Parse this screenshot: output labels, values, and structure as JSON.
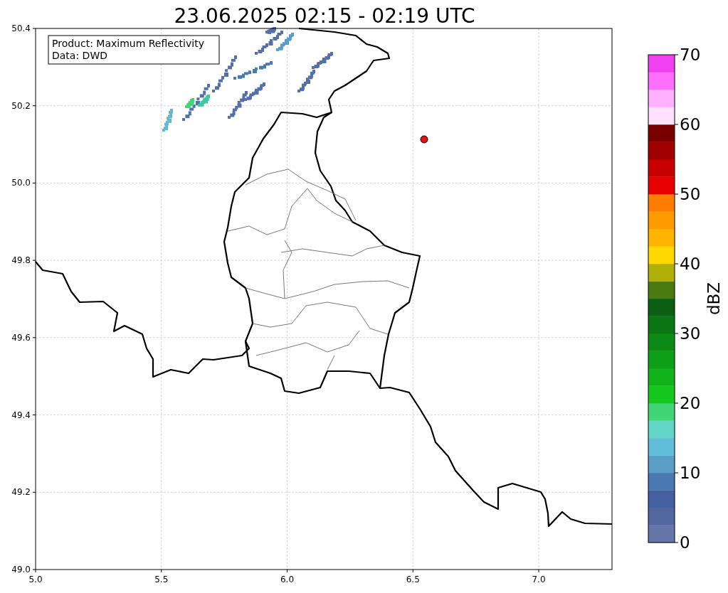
{
  "title": "23.06.2025 02:15 - 02:19 UTC",
  "legend": [
    "Product: Maximum Reflectivity",
    "Data: DWD"
  ],
  "map": {
    "x_ticks": [
      "5.0",
      "5.5",
      "6.0",
      "6.5",
      "7.0"
    ],
    "y_ticks": [
      "50.4",
      "50.2",
      "50.0",
      "49.8",
      "49.6",
      "49.4",
      "49.2",
      "49.0"
    ]
  },
  "colorbar": {
    "label": "dBZ",
    "ticks": [
      "70",
      "60",
      "50",
      "40",
      "30",
      "20",
      "10",
      "0"
    ],
    "segments": [
      {
        "color": "#6577a8"
      },
      {
        "color": "#5468a0"
      },
      {
        "color": "#4560a0"
      },
      {
        "color": "#4a78b0"
      },
      {
        "color": "#5a9ec8"
      },
      {
        "color": "#62bedb"
      },
      {
        "color": "#64d6c8"
      },
      {
        "color": "#40d678"
      },
      {
        "color": "#14c81e"
      },
      {
        "color": "#12b41c"
      },
      {
        "color": "#0fa01a"
      },
      {
        "color": "#0c8c17"
      },
      {
        "color": "#0b7614"
      },
      {
        "color": "#0b5e12"
      },
      {
        "color": "#4a7a10"
      },
      {
        "color": "#b0b008"
      },
      {
        "color": "#ffd700"
      },
      {
        "color": "#ffb400"
      },
      {
        "color": "#ff9a00"
      },
      {
        "color": "#ff7d00"
      },
      {
        "color": "#e60000"
      },
      {
        "color": "#c80000"
      },
      {
        "color": "#a00000"
      },
      {
        "color": "#780000"
      },
      {
        "color": "#ffe0ff"
      },
      {
        "color": "#ffb0ff"
      },
      {
        "color": "#ff70ff"
      },
      {
        "color": "#f040f0"
      }
    ]
  }
}
